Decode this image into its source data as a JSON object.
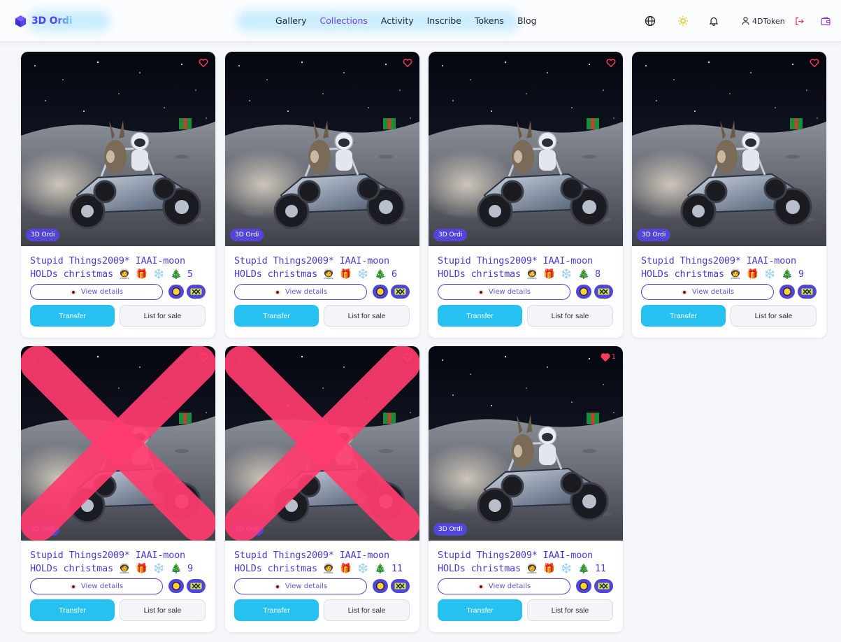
{
  "header": {
    "brand": "3D Ordi",
    "nav": [
      {
        "label": "Gallery",
        "active": false
      },
      {
        "label": "Collections",
        "active": true
      },
      {
        "label": "Activity",
        "active": false
      },
      {
        "label": "Inscribe",
        "active": false
      },
      {
        "label": "Tokens",
        "active": false
      },
      {
        "label": "Blog",
        "active": false
      }
    ],
    "icons": [
      "globe-icon",
      "sun-icon",
      "bell-icon",
      "user-icon",
      "logout-icon",
      "wallet-icon"
    ],
    "username": "4DToken"
  },
  "colors": {
    "accent": "#4f46d9",
    "active_nav": "#6a43e8",
    "transfer": "#26c1f0",
    "x_mark": "#ff3b6e"
  },
  "cards": [
    {
      "badge": "3D Ordi",
      "title": "Stupid Things2009* IAAI-moon HOLDs christmas 🧑‍🚀 🎁 ❄️ 🎄 5",
      "view": "View details",
      "transfer": "Transfer",
      "sale": "List for sale",
      "crossed": false,
      "like_count": ""
    },
    {
      "badge": "3D Ordi",
      "title": "Stupid Things2009* IAAI-moon HOLDs christmas 🧑‍🚀 🎁 ❄️ 🎄 6",
      "view": "View details",
      "transfer": "Transfer",
      "sale": "List for sale",
      "crossed": false,
      "like_count": ""
    },
    {
      "badge": "3D Ordi",
      "title": "Stupid Things2009* IAAI-moon HOLDs christmas 🧑‍🚀 🎁 ❄️ 🎄 8",
      "view": "View details",
      "transfer": "Transfer",
      "sale": "List for sale",
      "crossed": false,
      "like_count": ""
    },
    {
      "badge": "3D Ordi",
      "title": "Stupid Things2009* IAAI-moon HOLDs christmas 🧑‍🚀 🎁 ❄️ 🎄 9",
      "view": "View details",
      "transfer": "Transfer",
      "sale": "List for sale",
      "crossed": false,
      "like_count": ""
    },
    {
      "badge": "3D Ordi",
      "title": "Stupid Things2009* IAAI-moon HOLDs christmas 🧑‍🚀 🎁 ❄️ 🎄 9",
      "view": "View details",
      "transfer": "Transfer",
      "sale": "List for sale",
      "crossed": true,
      "like_count": ""
    },
    {
      "badge": "3D Ordi",
      "title": "Stupid Things2009* IAAI-moon HOLDs christmas 🧑‍🚀 🎁 ❄️ 🎄 11",
      "view": "View details",
      "transfer": "Transfer",
      "sale": "List for sale",
      "crossed": true,
      "like_count": ""
    },
    {
      "badge": "3D Ordi",
      "title": "Stupid Things2009* IAAI-moon HOLDs christmas 🧑‍🚀 🎁 ❄️ 🎄 11",
      "view": "View details",
      "transfer": "Transfer",
      "sale": "List for sale",
      "crossed": false,
      "like_count": "1"
    }
  ]
}
